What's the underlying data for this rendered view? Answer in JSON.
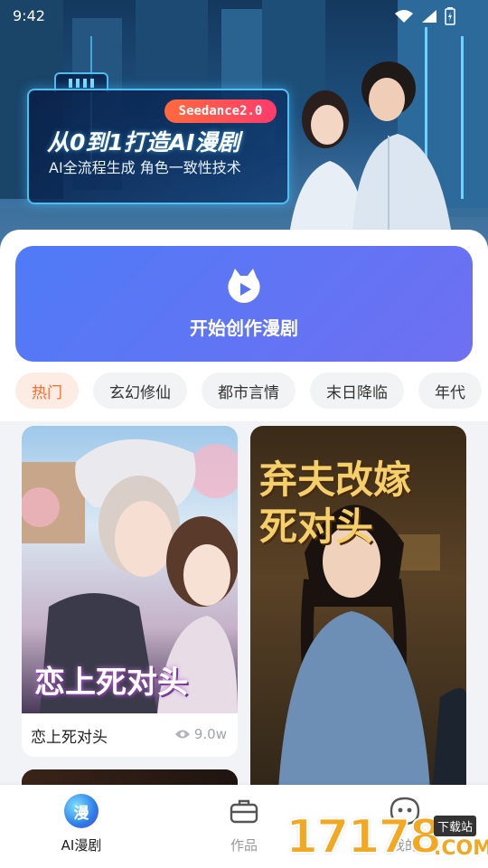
{
  "status_bar": {
    "time": "9:42",
    "icons": [
      "wifi-icon",
      "signal-icon",
      "battery-icon"
    ]
  },
  "banner": {
    "badge": "Seedance2.0",
    "title": "从0到1打造AI漫剧",
    "subtitle": "AI全流程生成 角色一致性技术"
  },
  "create": {
    "icon": "play-icon",
    "label": "开始创作漫剧"
  },
  "categories": [
    {
      "label": "热门",
      "active": true
    },
    {
      "label": "玄幻修仙",
      "active": false
    },
    {
      "label": "都市言情",
      "active": false
    },
    {
      "label": "末日降临",
      "active": false
    },
    {
      "label": "年代",
      "active": false
    }
  ],
  "cards": [
    {
      "cover_text": "恋上死对头",
      "title": "恋上死对头",
      "views": "9.0w"
    },
    {
      "cover_text_1": "弃夫改嫁",
      "cover_text_2": "死对头"
    }
  ],
  "bottom_nav": [
    {
      "label": "AI漫剧",
      "icon_text": "漫",
      "active": true
    },
    {
      "label": "作品",
      "active": false
    },
    {
      "label": "我的",
      "active": false
    }
  ],
  "watermark": {
    "number": "17178",
    "tag": "下载站",
    "domain": ".COM"
  },
  "colors": {
    "accent": "#5676f6",
    "chip_active_bg": "#fdece4",
    "chip_active_text": "#ff6a2a",
    "badge": "#ff5a4f"
  }
}
